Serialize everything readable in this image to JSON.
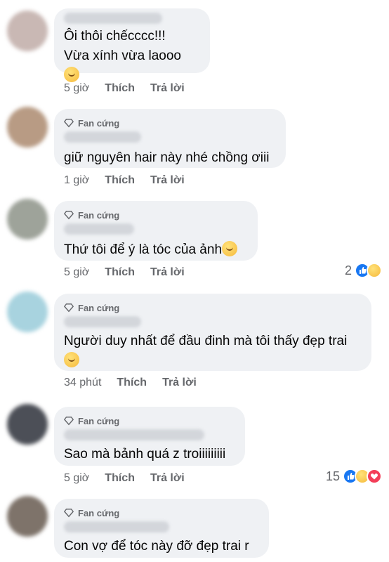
{
  "comments": [
    {
      "badge": "",
      "text": "Ôi thôi chếcccc!!!\nVừa xính vừa laooo",
      "emoji": "kissing-face-emoji",
      "time": "5 giờ",
      "like": "Thích",
      "reply": "Trả lời",
      "reaction_count": ""
    },
    {
      "badge": "Fan cứng",
      "text": "giữ nguyên hair này nhé chồng ơiii",
      "emoji": "",
      "time": "1 giờ",
      "like": "Thích",
      "reply": "Trả lời",
      "reaction_count": ""
    },
    {
      "badge": "Fan cứng",
      "text": "Thứ tôi để ý là tóc của ảnh",
      "emoji": "star-struck-emoji",
      "time": "5 giờ",
      "like": "Thích",
      "reply": "Trả lời",
      "reaction_count": "2"
    },
    {
      "badge": "Fan cứng",
      "text": "Người duy nhất để đầu đinh mà tôi thấy đẹp trai",
      "emoji": "pensive-face-emoji",
      "time": "34 phút",
      "like": "Thích",
      "reply": "Trả lời",
      "reaction_count": ""
    },
    {
      "badge": "Fan cứng",
      "text": "Sao mà bảnh quá z troiiiiiiiii",
      "emoji": "",
      "time": "5 giờ",
      "like": "Thích",
      "reply": "Trả lời",
      "reaction_count": "15"
    },
    {
      "badge": "Fan cứng",
      "text": "Con vợ để tóc này đỡ đẹp trai r",
      "emoji": "",
      "time": "",
      "like": "",
      "reply": "",
      "reaction_count": ""
    }
  ],
  "colors": {
    "bubble": "#eff1f4",
    "meta": "#65676b",
    "like": "#1877f2",
    "love": "#f33e58"
  }
}
